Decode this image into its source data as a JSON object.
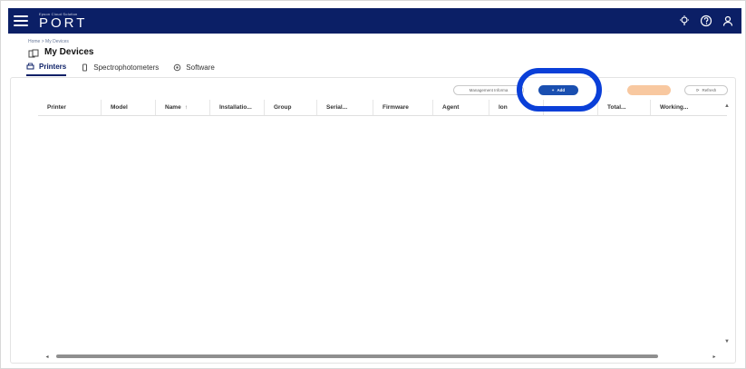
{
  "header": {
    "brand_subtitle": "Epson Cloud Solution",
    "brand_title": "PORT",
    "icons": [
      "menu-icon",
      "lightbulb-icon",
      "help-icon",
      "user-icon"
    ]
  },
  "breadcrumb": "Home  >  My Devices",
  "page_title": "My Devices",
  "tabs": [
    {
      "label": "Printers",
      "active": true,
      "icon": "printer-icon"
    },
    {
      "label": "Spectrophotometers",
      "active": false,
      "icon": "device-icon"
    },
    {
      "label": "Software",
      "active": false,
      "icon": "software-icon"
    }
  ],
  "toolbar": {
    "management_label": "Management Informa",
    "add_label": "Add",
    "faded_label": "...",
    "refresh_label": "Refresh"
  },
  "table": {
    "columns": [
      "Printer",
      "Model",
      "Name",
      "Installatio...",
      "Group",
      "Serial...",
      "Firmware",
      "Agent",
      "Ion",
      "",
      "Total...",
      "Working..."
    ],
    "sorted_column": "Name",
    "rows": []
  },
  "colors": {
    "header_bg": "#0b1f66",
    "add_button": "#1a4fb0",
    "highlight": "#0a3fd8"
  }
}
